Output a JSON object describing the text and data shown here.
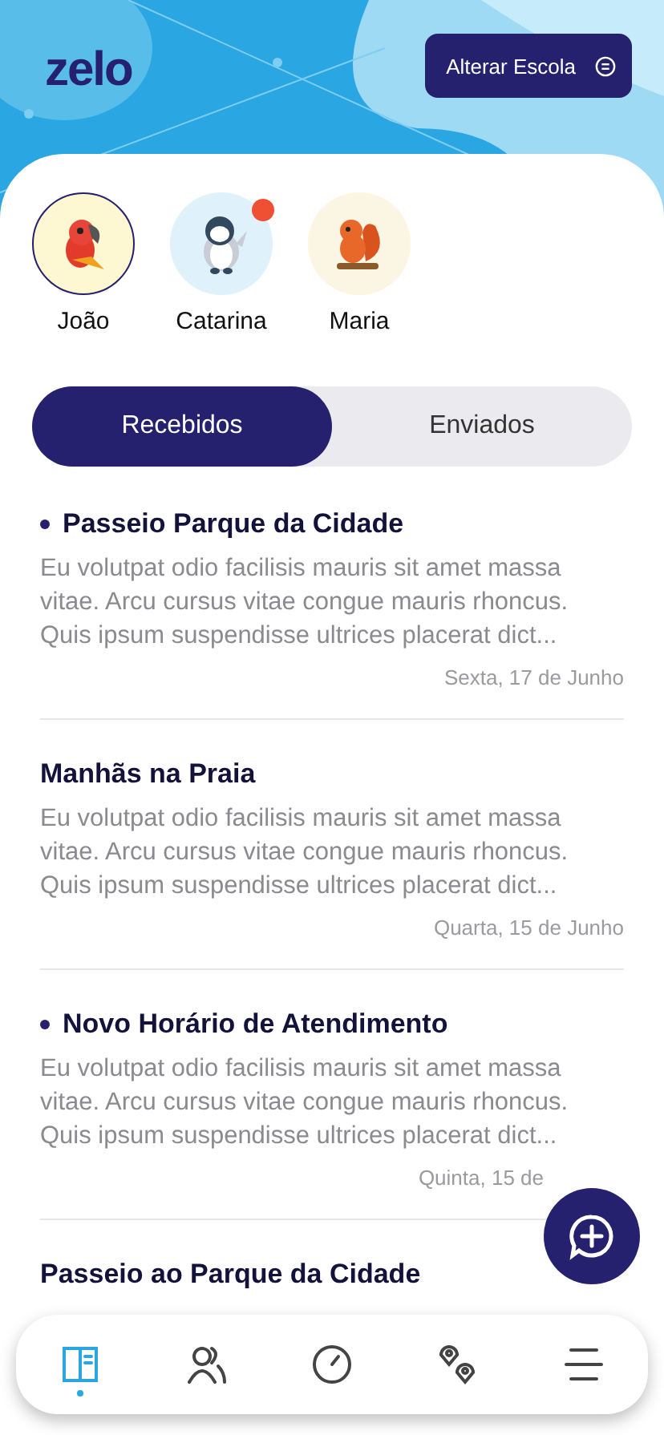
{
  "header": {
    "logo": "zelo",
    "school_button": {
      "label": "Alterar Escola"
    }
  },
  "students": [
    {
      "name": "João",
      "kind": "parrot",
      "selected": true,
      "has_notification": false
    },
    {
      "name": "Catarina",
      "kind": "penguin",
      "selected": false,
      "has_notification": true
    },
    {
      "name": "Maria",
      "kind": "squirrel",
      "selected": false,
      "has_notification": false
    }
  ],
  "tabs": [
    {
      "label": "Recebidos",
      "selected": true
    },
    {
      "label": "Enviados",
      "selected": false
    }
  ],
  "messages": [
    {
      "title": "Passeio Parque da Cidade",
      "unread": true,
      "body": "Eu volutpat odio facilisis mauris sit amet massa vitae. Arcu cursus vitae congue mauris rhoncus. Quis ipsum suspendisse ultrices placerat dict...",
      "date": "Sexta, 17 de Junho"
    },
    {
      "title": "Manhãs na Praia",
      "unread": false,
      "body": "Eu volutpat odio facilisis mauris sit amet massa vitae. Arcu cursus vitae congue mauris rhoncus. Quis ipsum suspendisse ultrices placerat dict...",
      "date": "Quarta, 15 de Junho"
    },
    {
      "title": "Novo Horário de Atendimento",
      "unread": true,
      "body": "Eu volutpat odio facilisis mauris sit amet massa vitae. Arcu cursus vitae congue mauris rhoncus. Quis ipsum suspendisse ultrices placerat dict...",
      "date": "Quinta, 15 de"
    },
    {
      "title": "Passeio ao Parque da Cidade",
      "unread": false
    }
  ],
  "nav": [
    {
      "kind": "book",
      "selected": true
    },
    {
      "kind": "users",
      "selected": false
    },
    {
      "kind": "gauge",
      "selected": false
    },
    {
      "kind": "pins",
      "selected": false
    },
    {
      "kind": "menu",
      "selected": false
    }
  ]
}
